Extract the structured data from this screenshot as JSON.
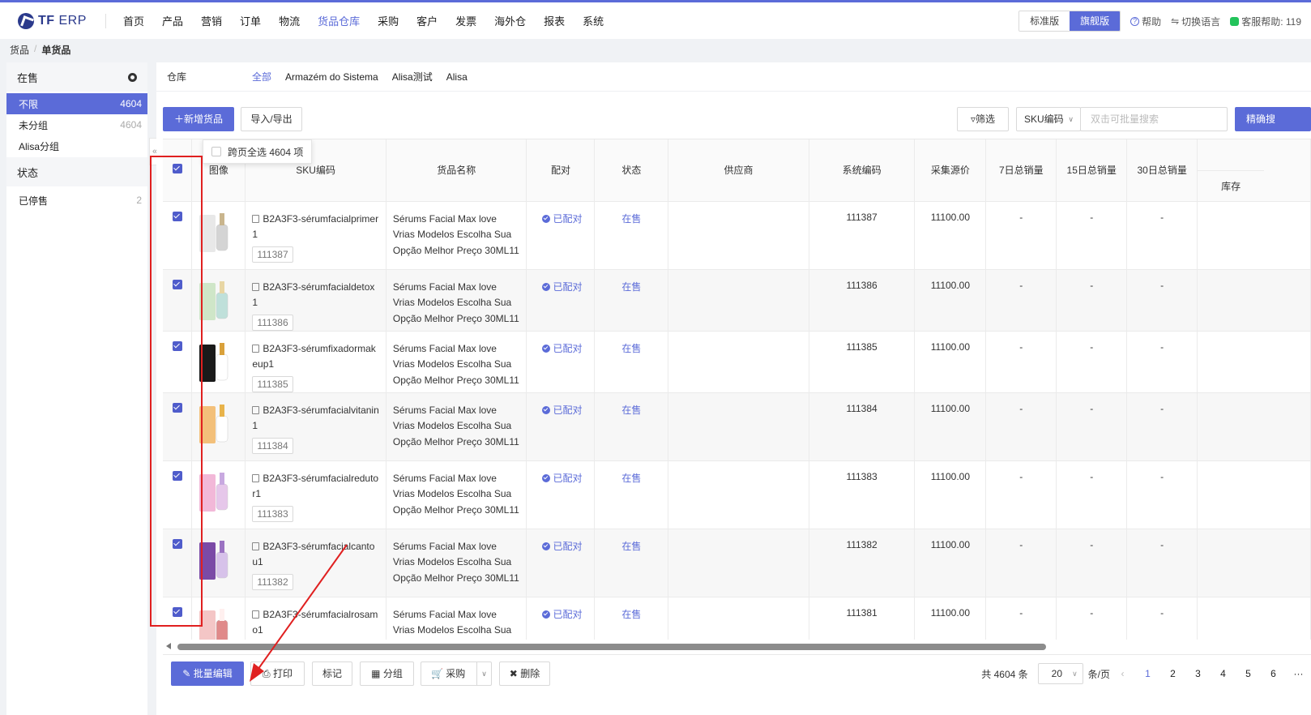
{
  "app": {
    "logo_tf": "TF",
    "logo_erp": " ERP",
    "nav": [
      "首页",
      "产品",
      "营销",
      "订单",
      "物流",
      "货品仓库",
      "采购",
      "客户",
      "发票",
      "海外仓",
      "报表",
      "系统"
    ],
    "active_nav": "货品仓库",
    "edition": {
      "standard": "标准版",
      "flagship": "旗舰版"
    },
    "help": "帮助",
    "language": "切换语言",
    "support": "客服帮助: 119"
  },
  "breadcrumb": {
    "parent": "货品",
    "current": "单货品"
  },
  "sidebar": {
    "section_on_sale": "在售",
    "items": [
      {
        "label": "不限",
        "count": "4604"
      },
      {
        "label": "未分组",
        "count": "4604"
      },
      {
        "label": "Alisa分组",
        "count": ""
      }
    ],
    "section_status": "状态",
    "status_items": [
      {
        "label": "已停售",
        "count": "2"
      }
    ]
  },
  "warehouse": {
    "label": "仓库",
    "options": [
      "全部",
      "Armazém do Sistema",
      "Alisa测试",
      "Alisa"
    ]
  },
  "toolbar": {
    "add_button": "新增货品",
    "import_export": "导入/导出",
    "filter": "筛选",
    "search_field": "SKU编码",
    "search_placeholder": "双击可批量搜索",
    "exact_search": "精确搜"
  },
  "table": {
    "select_all_pages": "跨页全选 4604 项",
    "headers": {
      "image": "图像",
      "sku": "SKU编码",
      "name": "货品名称",
      "match": "配对",
      "status": "状态",
      "supplier": "供应商",
      "sys_code": "系统编码",
      "price": "采集源价",
      "sales7": "7日总销量",
      "sales15": "15日总销量",
      "sales30": "30日总销量",
      "stock": "库存"
    },
    "rows": [
      {
        "sku": "B2A3F3-sérumfacialprimer1",
        "id": "111387",
        "name": "Sérums Facial Max love Vrias Modelos Escolha Sua Opção Melhor Preço 30ML11",
        "match": "已配对",
        "status": "在售",
        "supplier": "",
        "code": "111387",
        "price": "11100.00",
        "s7": "-",
        "s15": "-",
        "s30": "-"
      },
      {
        "sku": "B2A3F3-sérumfacialdetox1",
        "id": "111386",
        "name": "Sérums Facial Max love Vrias Modelos Escolha Sua Opção Melhor Preço 30ML11",
        "match": "已配对",
        "status": "在售",
        "supplier": "",
        "code": "111386",
        "price": "11100.00",
        "s7": "-",
        "s15": "-",
        "s30": "-"
      },
      {
        "sku": "B2A3F3-sérumfixadormakeup1",
        "id": "111385",
        "name": "Sérums Facial Max love Vrias Modelos Escolha Sua Opção Melhor Preço 30ML11",
        "match": "已配对",
        "status": "在售",
        "supplier": "",
        "code": "111385",
        "price": "11100.00",
        "s7": "-",
        "s15": "-",
        "s30": "-"
      },
      {
        "sku": "B2A3F3-sérumfacialvitanin1",
        "id": "111384",
        "name": "Sérums Facial Max love Vrias Modelos Escolha Sua Opção Melhor Preço 30ML11",
        "match": "已配对",
        "status": "在售",
        "supplier": "",
        "code": "111384",
        "price": "11100.00",
        "s7": "-",
        "s15": "-",
        "s30": "-"
      },
      {
        "sku": "B2A3F3-sérumfacialredutor1",
        "id": "111383",
        "name": "Sérums Facial Max love Vrias Modelos Escolha Sua Opção Melhor Preço 30ML11",
        "match": "已配对",
        "status": "在售",
        "supplier": "",
        "code": "111383",
        "price": "11100.00",
        "s7": "-",
        "s15": "-",
        "s30": "-"
      },
      {
        "sku": "B2A3F3-sérumfacialcantou1",
        "id": "111382",
        "name": "Sérums Facial Max love Vrias Modelos Escolha Sua Opção Melhor Preço 30ML11",
        "match": "已配对",
        "status": "在售",
        "supplier": "",
        "code": "111382",
        "price": "11100.00",
        "s7": "-",
        "s15": "-",
        "s30": "-"
      },
      {
        "sku": "B2A3F3-sérumfacialrosam o1",
        "id": "",
        "name": "Sérums Facial Max love Vrias Modelos Escolha Sua Opção",
        "match": "已配对",
        "status": "在售",
        "supplier": "",
        "code": "111381",
        "price": "11100.00",
        "s7": "-",
        "s15": "-",
        "s30": "-"
      }
    ]
  },
  "bottom": {
    "batch_edit": "批量编辑",
    "print": "打印",
    "mark": "标记",
    "group": "分组",
    "purchase": "采购",
    "delete": "删除",
    "total": "共 4604 条",
    "page_size": "20",
    "per_page": "条/页",
    "pages": [
      "1",
      "2",
      "3",
      "4",
      "5",
      "6"
    ],
    "more": "···"
  },
  "colors": {
    "accent": "#5b6bd8",
    "annotation": "#e02020"
  }
}
